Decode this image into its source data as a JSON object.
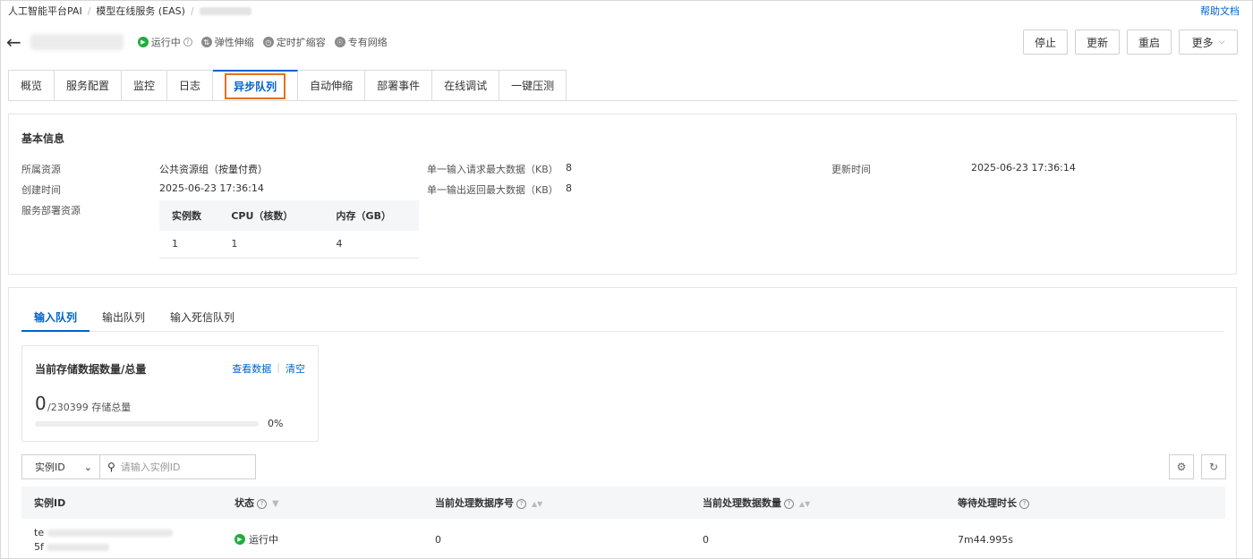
{
  "breadcrumb": [
    "人工智能平台PAI",
    "模型在线服务 (EAS)"
  ],
  "help_link": "帮助文档",
  "header": {
    "status": "运行中",
    "tags": [
      "弹性伸缩",
      "定时扩缩容",
      "专有网络"
    ]
  },
  "actions": [
    "停止",
    "更新",
    "重启",
    "更多"
  ],
  "tabs": [
    "概览",
    "服务配置",
    "监控",
    "日志",
    "异步队列",
    "自动伸缩",
    "部署事件",
    "在线调试",
    "一键压测"
  ],
  "basic_info": {
    "title": "基本信息",
    "resource_label": "所属资源",
    "resource_value": "公共资源组（按量付费）",
    "created_label": "创建时间",
    "created_value": "2025-06-23 17:36:14",
    "deploy_label": "服务部署资源",
    "input_max_label": "单一输入请求最大数据（KB）",
    "input_max_value": "8",
    "output_max_label": "单一输出返回最大数据（KB）",
    "output_max_value": "8",
    "updated_label": "更新时间",
    "updated_value": "2025-06-23 17:36:14",
    "resource_table": {
      "headers": [
        "实例数",
        "CPU（核数）",
        "内存（GB）"
      ],
      "row": [
        "1",
        "1",
        "4"
      ]
    }
  },
  "queue": {
    "tabs": [
      "输入队列",
      "输出队列",
      "输入死信队列"
    ],
    "storage": {
      "title": "当前存储数据数量/总量",
      "view_link": "查看数据",
      "clear_link": "清空",
      "current": "0",
      "total": "/230399 存储总量",
      "percent_text": "0%",
      "progress": 0
    },
    "filter": {
      "select_value": "实例ID",
      "search_placeholder": "请输入实例ID"
    },
    "table": {
      "headers": [
        "实例ID",
        "状态",
        "当前处理数据序号",
        "当前处理数据数量",
        "等待处理时长"
      ],
      "rows": [
        {
          "id_prefix_1": "te",
          "id_prefix_2": "5f",
          "status": "运行中",
          "seq": "0",
          "count": "0",
          "wait": "7m44.995s"
        }
      ]
    }
  },
  "colors": {
    "accent": "#0064c8",
    "highlight": "#e6701f",
    "running": "#1fae3d"
  }
}
